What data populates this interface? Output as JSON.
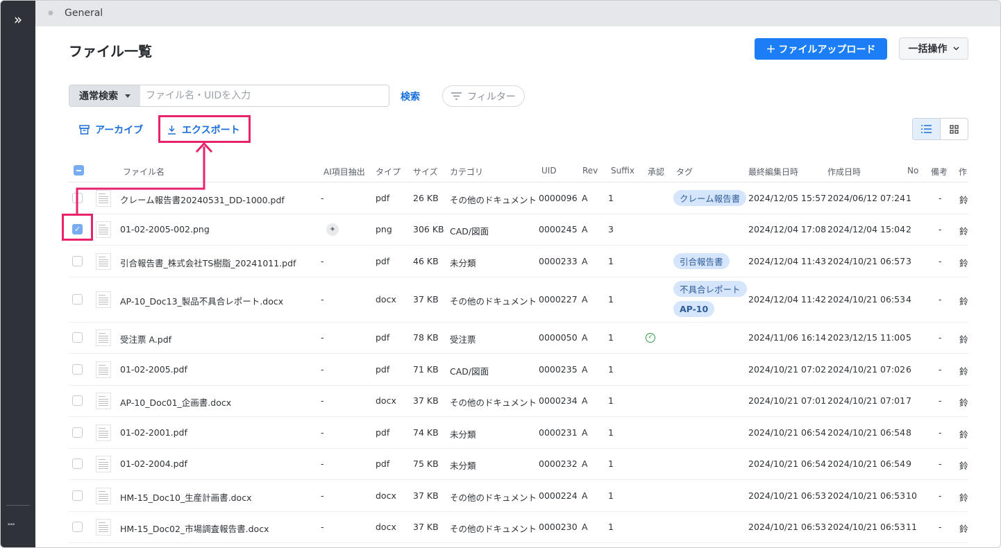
{
  "sidebar": {
    "expand_glyph": "»"
  },
  "topbar": {
    "title": "General"
  },
  "page": {
    "title": "ファイル一覧"
  },
  "toolbar": {
    "upload_label": "＋ ファイルアップロード",
    "bulk_label": "一括操作",
    "search_mode": "通常検索",
    "search_placeholder": "ファイル名・UIDを入力",
    "search_button": "検索",
    "filter_label": "フィルター",
    "archive_label": "アーカイブ",
    "export_label": "エクスポート"
  },
  "colors": {
    "accent": "#1b7ef5",
    "highlight": "#e8236c",
    "tag_bg": "#d5e5fb",
    "sidebar": "#2f3339"
  },
  "table": {
    "headers": [
      "ファイル名",
      "AI項目抽出",
      "タイプ",
      "サイズ",
      "カテゴリ",
      "UID",
      "Rev",
      "Suffix",
      "承認",
      "タグ",
      "最終編集日時",
      "作成日時",
      "No",
      "備考",
      "作"
    ],
    "rows": [
      {
        "name": "クレーム報告書20240531_DD-1000.pdf",
        "ai": "-",
        "type": "pdf",
        "size": "26 KB",
        "category": "その他のドキュメント",
        "uid": "0000096",
        "rev": "A",
        "suffix": "1",
        "approved": false,
        "tags": [
          "クレーム報告書"
        ],
        "modified": "2024/12/05 15:57",
        "created": "2024/06/12 07:24",
        "no": "1",
        "note": "-",
        "author": "鈴木",
        "checked": false
      },
      {
        "name": "01-02-2005-002.png",
        "ai": "icon",
        "type": "png",
        "size": "306 KB",
        "category": "CAD/図面",
        "uid": "0000245",
        "rev": "A",
        "suffix": "3",
        "approved": false,
        "tags": [],
        "modified": "2024/12/04 17:08",
        "created": "2024/12/04 15:04",
        "no": "2",
        "note": "-",
        "author": "鈴木",
        "checked": true
      },
      {
        "name": "引合報告書_株式会社TS樹脂_20241011.pdf",
        "ai": "-",
        "type": "pdf",
        "size": "46 KB",
        "category": "未分類",
        "uid": "0000233",
        "rev": "A",
        "suffix": "1",
        "approved": false,
        "tags": [
          "引合報告書"
        ],
        "modified": "2024/12/04 11:43",
        "created": "2024/10/21 06:57",
        "no": "3",
        "note": "-",
        "author": "鈴木",
        "checked": false
      },
      {
        "name": "AP-10_Doc13_製品不具合レポート.docx",
        "ai": "-",
        "type": "docx",
        "size": "37 KB",
        "category": "その他のドキュメント",
        "uid": "0000227",
        "rev": "A",
        "suffix": "1",
        "approved": false,
        "tags": [
          "不具合レポート",
          "AP-10"
        ],
        "modified": "2024/12/04 11:42",
        "created": "2024/10/21 06:53",
        "no": "4",
        "note": "-",
        "author": "鈴木",
        "checked": false
      },
      {
        "name": "受注票 A.pdf",
        "ai": "-",
        "type": "pdf",
        "size": "78 KB",
        "category": "受注票",
        "uid": "0000050",
        "rev": "A",
        "suffix": "1",
        "approved": true,
        "tags": [],
        "modified": "2024/11/06 16:14",
        "created": "2023/12/15 11:00",
        "no": "5",
        "note": "-",
        "author": "鈴木",
        "checked": false
      },
      {
        "name": "01-02-2005.pdf",
        "ai": "-",
        "type": "pdf",
        "size": "71 KB",
        "category": "CAD/図面",
        "uid": "0000235",
        "rev": "A",
        "suffix": "1",
        "approved": false,
        "tags": [],
        "modified": "2024/10/21 07:02",
        "created": "2024/10/21 07:02",
        "no": "6",
        "note": "-",
        "author": "鈴木",
        "checked": false
      },
      {
        "name": "AP-10_Doc01_企画書.docx",
        "ai": "-",
        "type": "docx",
        "size": "37 KB",
        "category": "その他のドキュメント",
        "uid": "0000234",
        "rev": "A",
        "suffix": "1",
        "approved": false,
        "tags": [],
        "modified": "2024/10/21 07:01",
        "created": "2024/10/21 07:01",
        "no": "7",
        "note": "-",
        "author": "鈴木",
        "checked": false
      },
      {
        "name": "01-02-2001.pdf",
        "ai": "-",
        "type": "pdf",
        "size": "74 KB",
        "category": "未分類",
        "uid": "0000231",
        "rev": "A",
        "suffix": "1",
        "approved": false,
        "tags": [],
        "modified": "2024/10/21 06:54",
        "created": "2024/10/21 06:54",
        "no": "8",
        "note": "-",
        "author": "鈴木",
        "checked": false
      },
      {
        "name": "01-02-2004.pdf",
        "ai": "-",
        "type": "pdf",
        "size": "75 KB",
        "category": "未分類",
        "uid": "0000232",
        "rev": "A",
        "suffix": "1",
        "approved": false,
        "tags": [],
        "modified": "2024/10/21 06:54",
        "created": "2024/10/21 06:54",
        "no": "9",
        "note": "-",
        "author": "鈴木",
        "checked": false
      },
      {
        "name": "HM-15_Doc10_生産計画書.docx",
        "ai": "-",
        "type": "docx",
        "size": "37 KB",
        "category": "その他のドキュメント",
        "uid": "0000224",
        "rev": "A",
        "suffix": "1",
        "approved": false,
        "tags": [],
        "modified": "2024/10/21 06:53",
        "created": "2024/10/21 06:53",
        "no": "10",
        "note": "-",
        "author": "鈴木",
        "checked": false
      },
      {
        "name": "HM-15_Doc02_市場調査報告書.docx",
        "ai": "-",
        "type": "docx",
        "size": "37 KB",
        "category": "その他のドキュメント",
        "uid": "0000230",
        "rev": "A",
        "suffix": "1",
        "approved": false,
        "tags": [],
        "modified": "2024/10/21 06:53",
        "created": "2024/10/21 06:53",
        "no": "11",
        "note": "-",
        "author": "鈴木",
        "checked": false
      }
    ]
  }
}
